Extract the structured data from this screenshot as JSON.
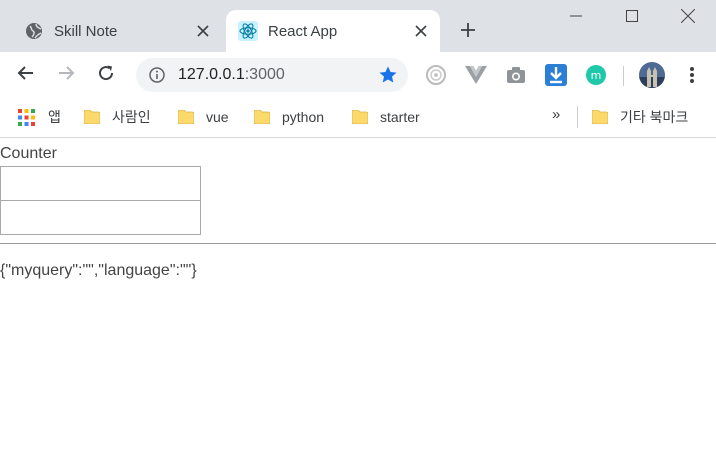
{
  "browser": {
    "tabs": [
      {
        "title": "Skill Note",
        "icon": "globe-icon",
        "active": false
      },
      {
        "title": "React App",
        "icon": "react-logo-icon",
        "active": true
      }
    ],
    "new_tab_icon": "plus-icon",
    "window_controls": [
      "minimize-icon",
      "maximize-icon",
      "close-icon"
    ]
  },
  "toolbar": {
    "url_host": "127.0.0.1",
    "url_port": ":3000",
    "nav_icons": [
      "back-icon",
      "forward-icon",
      "reload-icon"
    ],
    "extensions": [
      "circle-extension-icon",
      "vue-devtools-icon",
      "camera-icon",
      "download-icon",
      "m-extension-icon",
      "profile-avatar-icon",
      "menu-dots-icon"
    ],
    "accent_color": "#1a73e8"
  },
  "bookmarks": {
    "apps_label": "앱",
    "items": [
      "사람인",
      "vue",
      "python",
      "starter"
    ],
    "more_label": "»",
    "other_label": "기타 북마크"
  },
  "page": {
    "title": "Counter",
    "input1_value": "",
    "input2_value": "",
    "output": "{\"myquery\":\"\",\"language\":\"\"}"
  }
}
